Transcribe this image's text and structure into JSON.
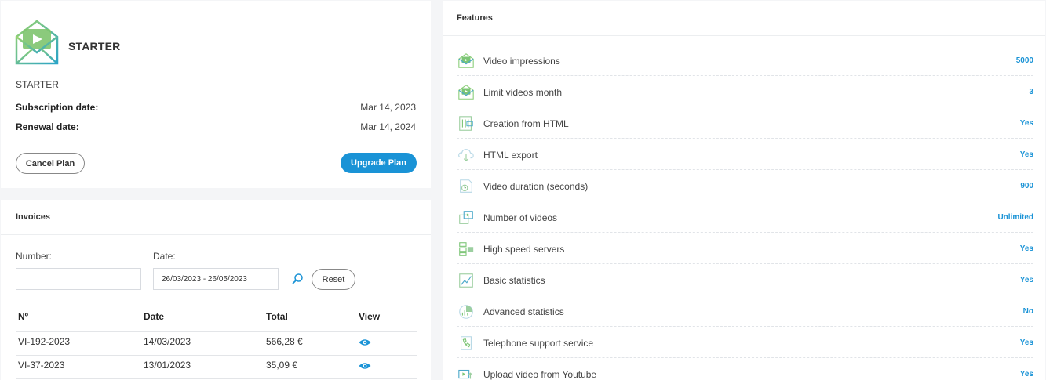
{
  "plan": {
    "title": "STARTER",
    "name": "STARTER",
    "subscription_label": "Subscription date:",
    "subscription_value": "Mar 14, 2023",
    "renewal_label": "Renewal date:",
    "renewal_value": "Mar 14, 2024",
    "cancel_label": "Cancel Plan",
    "upgrade_label": "Upgrade Plan"
  },
  "invoices": {
    "header": "Invoices",
    "number_label": "Number:",
    "number_value": "",
    "date_label": "Date:",
    "date_value": "26/03/2023 - 26/05/2023",
    "reset_label": "Reset",
    "columns": [
      "Nº",
      "Date",
      "Total",
      "View"
    ],
    "rows": [
      {
        "number": "VI-192-2023",
        "date": "14/03/2023",
        "total": "566,28 €"
      },
      {
        "number": "VI-37-2023",
        "date": "13/01/2023",
        "total": "35,09 €"
      }
    ]
  },
  "features": {
    "header": "Features",
    "items": [
      {
        "label": "Video impressions",
        "value": "5000",
        "icon": "video-envelope-icon"
      },
      {
        "label": "Limit videos month",
        "value": "3",
        "icon": "video-envelope-icon"
      },
      {
        "label": "Creation from HTML",
        "value": "Yes",
        "icon": "html-code-icon"
      },
      {
        "label": "HTML export",
        "value": "Yes",
        "icon": "cloud-export-icon"
      },
      {
        "label": "Video duration (seconds)",
        "value": "900",
        "icon": "duration-icon"
      },
      {
        "label": "Number of videos",
        "value": "Unlimited",
        "icon": "videos-count-icon"
      },
      {
        "label": "High speed servers",
        "value": "Yes",
        "icon": "servers-icon"
      },
      {
        "label": "Basic statistics",
        "value": "Yes",
        "icon": "chart-line-icon"
      },
      {
        "label": "Advanced statistics",
        "value": "No",
        "icon": "pie-chart-icon"
      },
      {
        "label": "Telephone support service",
        "value": "Yes",
        "icon": "phone-icon"
      },
      {
        "label": "Upload video from Youtube",
        "value": "Yes",
        "icon": "upload-video-icon"
      }
    ]
  },
  "colors": {
    "accent": "#1a93d6",
    "icon_green": "#7cc576",
    "icon_teal": "#4aa8c9"
  }
}
